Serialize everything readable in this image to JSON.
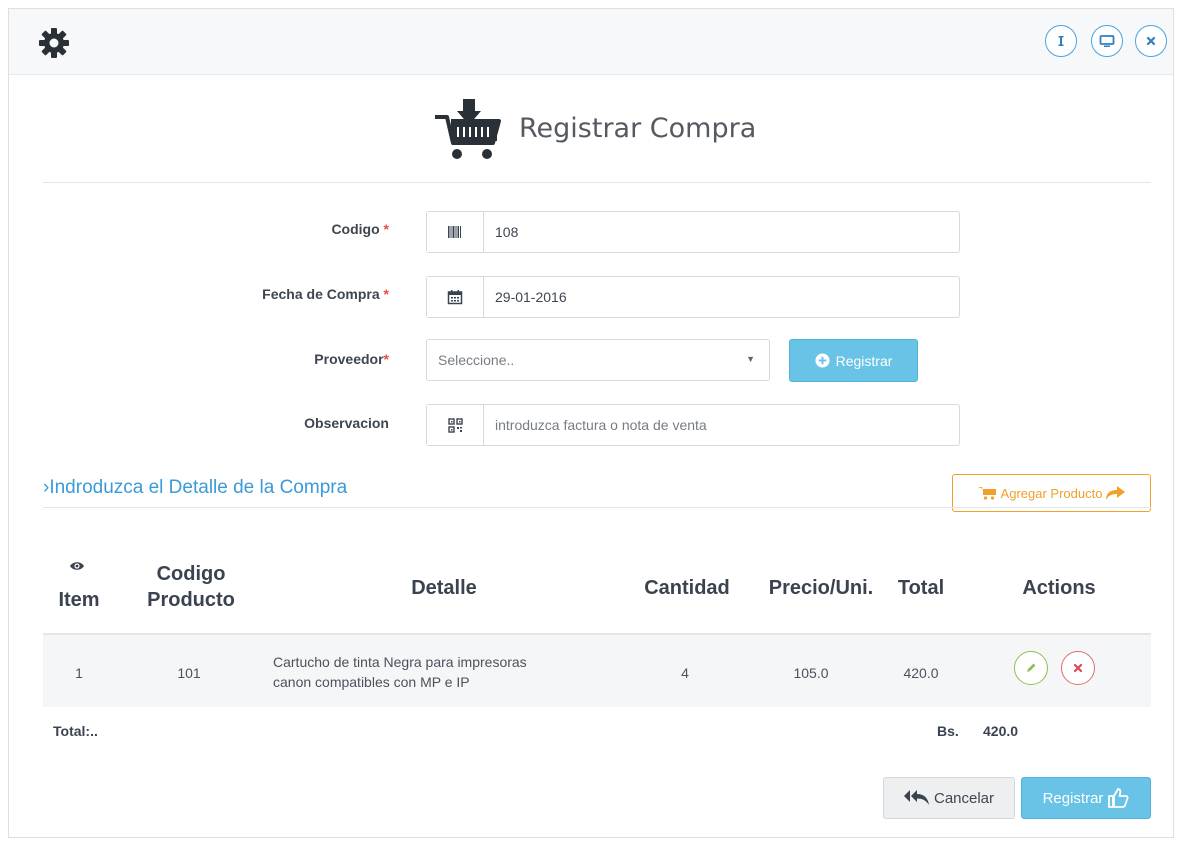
{
  "window": {
    "icons": [
      "gear-icon",
      "info-icon",
      "monitor-icon",
      "close-icon"
    ],
    "accent": "#4aa3df"
  },
  "header": {
    "title": "Registrar Compra",
    "icon": "cart-download-icon"
  },
  "form": {
    "codigo": {
      "label": "Codigo",
      "required_mark": "*",
      "value": "108",
      "icon": "barcode-icon"
    },
    "fecha": {
      "label": "Fecha de Compra",
      "required_mark": "*",
      "value": "29-01-2016",
      "icon": "calendar-icon"
    },
    "proveedor": {
      "label": "Proveedor",
      "required_mark": "*",
      "placeholder": "Seleccione..",
      "button_label": "Registrar"
    },
    "observacion": {
      "label": "Observacion",
      "placeholder": "introduzca factura o nota de venta",
      "icon": "qrcode-icon"
    }
  },
  "detail": {
    "section_title": "Indroduzca el Detalle de la Compra",
    "section_prefix": "›",
    "add_button_label": "Agregar Producto",
    "columns": {
      "item": "Item",
      "codigo_1": "Codigo",
      "codigo_2": "Producto",
      "detalle": "Detalle",
      "cantidad": "Cantidad",
      "precio": "Precio/Uni.",
      "total": "Total",
      "actions": "Actions"
    },
    "rows": [
      {
        "item": "1",
        "codigo": "101",
        "detalle_1": "Cartucho de tinta Negra para impresoras",
        "detalle_2": "canon compatibles con MP e IP",
        "cantidad": "4",
        "precio": "105.0",
        "total": "420.0"
      }
    ],
    "total_label": "Total:..",
    "total_currency": "Bs.",
    "total_value": "420.0"
  },
  "footer": {
    "cancel_label": "Cancelar",
    "submit_label": "Registrar"
  },
  "colors": {
    "primary": "#68c3e6",
    "warning": "#f0a02b",
    "success": "#8cc152",
    "danger": "#e36d6d",
    "required": "#e54d42",
    "link": "#3b9ad8"
  }
}
